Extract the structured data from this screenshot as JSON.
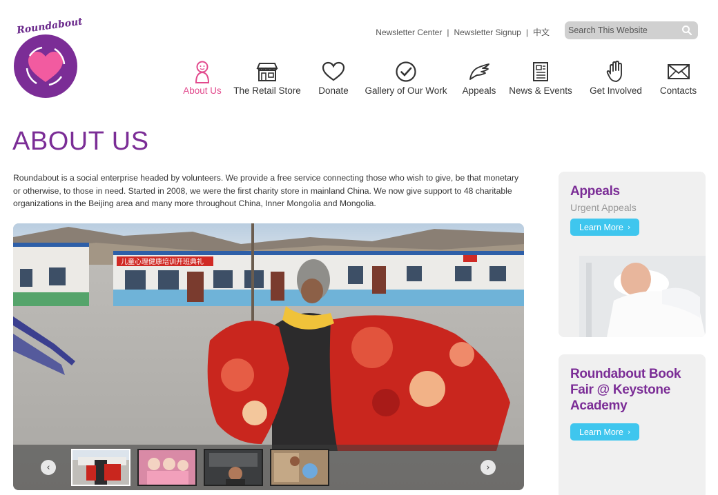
{
  "logo": {
    "text": "Roundabout"
  },
  "util_links": [
    {
      "label": "Newsletter Center"
    },
    {
      "label": "Newsletter Signup"
    },
    {
      "label": "中文"
    }
  ],
  "search": {
    "placeholder": "Search This Website"
  },
  "nav": [
    {
      "label": "About Us",
      "icon": "person-icon",
      "active": true
    },
    {
      "label": "The Retail Store",
      "icon": "store-icon"
    },
    {
      "label": "Donate",
      "icon": "heart-icon"
    },
    {
      "label": "Gallery of Our Work",
      "icon": "checkmark-circle-icon"
    },
    {
      "label": "Appeals",
      "icon": "wing-icon"
    },
    {
      "label": "News & Events",
      "icon": "newspaper-icon"
    },
    {
      "label": "Get Involved",
      "icon": "hand-icon"
    },
    {
      "label": "Contacts",
      "icon": "envelope-icon"
    }
  ],
  "page_title": "ABOUT US",
  "intro": "Roundabout is a social enterprise headed by volunteers. We provide a free service connecting those who wish to give, be that monetary or otherwise, to those in need. Started in 2008, we were the first charity store in mainland China. We now give support to 48 charitable organizations in the Beijing area and many more throughout China, Inner Mongolia and Mongolia.",
  "slider": {
    "banner_text": "儿童心理健康培训开班典礼",
    "prev": "‹",
    "next": "›"
  },
  "sidebar": {
    "appeals": {
      "title": "Appeals",
      "subtitle": "Urgent Appeals",
      "button": "Learn More"
    },
    "bookfair": {
      "title": "Roundabout Book Fair @ Keystone Academy",
      "button": "Learn More"
    }
  },
  "colors": {
    "brand_purple": "#7b2d96",
    "accent_pink": "#e24a8d",
    "button_blue": "#3fc6ee"
  }
}
